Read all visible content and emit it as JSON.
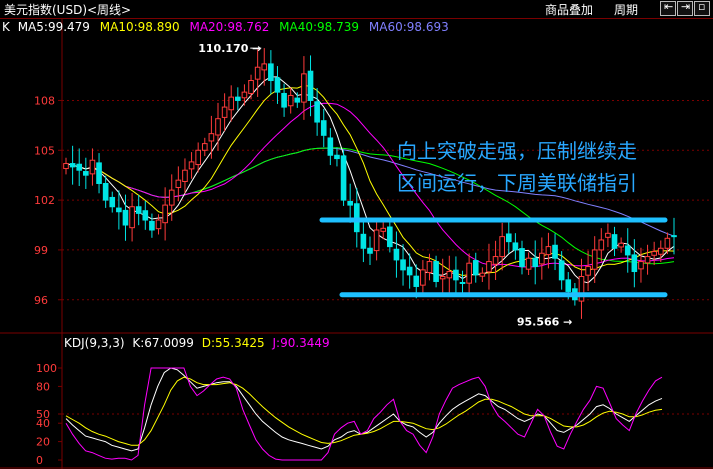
{
  "header": {
    "title": "美元指数(USD)<周线>",
    "overlay_label": "商品叠加",
    "period_label": "周期"
  },
  "main_legend": {
    "prefix": "K",
    "ma5": "MA5:99.479",
    "ma10": "MA10:98.890",
    "ma20": "MA20:98.762",
    "ma40": "MA40:98.739",
    "ma60": "MA60:98.693"
  },
  "kdj_legend": {
    "name": "KDJ(9,3,3)",
    "k": "K:67.0099",
    "d": "D:55.3425",
    "j": "J:90.3449"
  },
  "colors": {
    "up": "#ff3b3b",
    "down": "#00e5e5",
    "ma5": "#ffffff",
    "ma10": "#ffff00",
    "ma20": "#ff00ff",
    "ma40": "#00ff00",
    "ma60": "#8080ff",
    "grid": "#7a0000",
    "axis_text": "#ff3b3b",
    "annotation": "#29a8ff",
    "bands": "#1ec0ff"
  },
  "chart_data": [
    {
      "type": "candlestick",
      "title": "美元指数(USD)<周线>",
      "ylim": [
        94.3,
        112
      ],
      "y_ticks": [
        96,
        99,
        102,
        105,
        108
      ],
      "high_label": "110.170",
      "low_label": "95.566",
      "annotation_line1": "向上突破走强，压制继续走",
      "annotation_line2": "区间运行，下周美联储指引",
      "resistance_level": 100.8,
      "support_level": 96.3,
      "close": [
        104.2,
        104.0,
        103.8,
        103.5,
        104.4,
        103.0,
        102.0,
        101.6,
        101.3,
        100.5,
        101.6,
        101.2,
        100.8,
        100.2,
        100.8,
        101.7,
        102.6,
        103.2,
        103.8,
        104.3,
        105.0,
        105.4,
        106.0,
        106.9,
        107.6,
        108.2,
        108.0,
        108.5,
        109.2,
        110.0,
        110.2,
        109.2,
        108.5,
        107.6,
        108.3,
        107.9,
        109.6,
        108.0,
        106.7,
        105.9,
        104.7,
        104.5,
        102.0,
        101.7,
        100.1,
        99.1,
        98.8,
        100.2,
        100.3,
        99.2,
        98.4,
        97.8,
        97.5,
        96.8,
        97.8,
        98.3,
        97.1,
        97.4,
        97.7,
        97.2,
        97.0,
        98.2,
        97.5,
        97.6,
        98.3,
        98.6,
        99.8,
        99.5,
        99.0,
        98.0,
        98.5,
        98.0,
        98.8,
        99.2,
        98.5,
        97.2,
        96.5,
        96.0,
        97.4,
        98.0,
        99.0,
        99.6,
        100.0,
        99.1,
        99.4,
        98.7,
        97.7,
        98.3,
        98.6,
        98.9,
        99.1,
        99.7,
        99.8
      ]
    },
    {
      "type": "line",
      "title": "KDJ(9,3,3)",
      "ylim": [
        0,
        100
      ],
      "y_ticks": [
        0,
        20,
        40,
        50,
        80,
        100
      ],
      "series": [
        {
          "name": "K",
          "values": [
            45,
            38,
            32,
            26,
            24,
            22,
            20,
            16,
            14,
            12,
            10,
            12,
            35,
            60,
            80,
            95,
            100,
            98,
            92,
            85,
            78,
            80,
            82,
            84,
            85,
            85,
            80,
            70,
            60,
            50,
            42,
            36,
            30,
            25,
            22,
            20,
            18,
            16,
            14,
            12,
            15,
            22,
            25,
            30,
            32,
            28,
            30,
            35,
            40,
            45,
            50,
            42,
            38,
            36,
            30,
            25,
            30,
            40,
            48,
            55,
            60,
            64,
            68,
            72,
            70,
            64,
            58,
            55,
            50,
            45,
            42,
            45,
            50,
            48,
            40,
            32,
            30,
            34,
            38,
            44,
            50,
            58,
            60,
            56,
            50,
            46,
            42,
            48,
            54,
            60,
            64,
            67
          ]
        },
        {
          "name": "D",
          "values": [
            48,
            44,
            40,
            35,
            31,
            28,
            26,
            23,
            20,
            18,
            16,
            16,
            22,
            32,
            46,
            60,
            76,
            86,
            90,
            88,
            84,
            82,
            82,
            82,
            83,
            84,
            82,
            78,
            72,
            65,
            58,
            52,
            46,
            41,
            36,
            32,
            28,
            25,
            22,
            19,
            18,
            19,
            21,
            24,
            27,
            28,
            29,
            31,
            34,
            38,
            42,
            42,
            41,
            40,
            37,
            34,
            33,
            35,
            39,
            44,
            49,
            53,
            58,
            63,
            66,
            66,
            64,
            61,
            58,
            54,
            50,
            48,
            48,
            48,
            45,
            41,
            37,
            36,
            36,
            38,
            42,
            47,
            51,
            53,
            52,
            50,
            47,
            47,
            49,
            52,
            54,
            55
          ]
        },
        {
          "name": "J",
          "values": [
            40,
            28,
            18,
            10,
            8,
            5,
            2,
            1,
            2,
            2,
            0,
            5,
            60,
            100,
            100,
            100,
            100,
            100,
            100,
            80,
            70,
            75,
            82,
            88,
            90,
            88,
            78,
            55,
            38,
            22,
            12,
            5,
            1,
            0,
            0,
            0,
            0,
            0,
            0,
            0,
            8,
            28,
            35,
            40,
            42,
            28,
            32,
            45,
            52,
            60,
            66,
            42,
            32,
            28,
            16,
            8,
            25,
            50,
            65,
            78,
            82,
            85,
            88,
            90,
            80,
            60,
            48,
            42,
            35,
            28,
            25,
            40,
            55,
            48,
            30,
            15,
            12,
            28,
            42,
            55,
            65,
            80,
            78,
            62,
            45,
            38,
            32,
            50,
            64,
            76,
            86,
            90
          ]
        }
      ]
    }
  ]
}
